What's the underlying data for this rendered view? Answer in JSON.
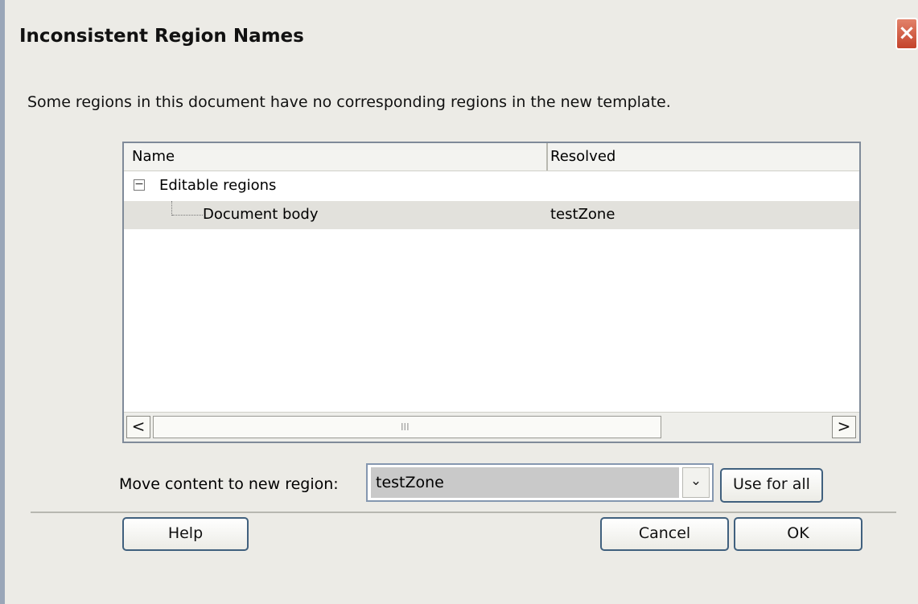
{
  "dialog": {
    "title": "Inconsistent Region Names",
    "instruction": "Some regions in this document have no corresponding regions in the new template."
  },
  "tree": {
    "columns": [
      "Name",
      "Resolved"
    ],
    "expander_symbol": "−",
    "parent_label": "Editable regions",
    "child_label": "Document body",
    "child_resolved": "testZone"
  },
  "scrollbar": {
    "left_arrow": "<",
    "right_arrow": ">",
    "grip": "III"
  },
  "controls": {
    "move_label": "Move content to new region:",
    "selected_region": "testZone",
    "dropdown_arrow": "⌄",
    "use_for_all": "Use for all",
    "help": "Help",
    "cancel": "Cancel",
    "ok": "OK",
    "close": "×"
  },
  "colors": {
    "background": "#ecebe6",
    "selected_row": "#e2e1dc",
    "close_button": "#d45f3f",
    "button_border": "#40607e"
  }
}
